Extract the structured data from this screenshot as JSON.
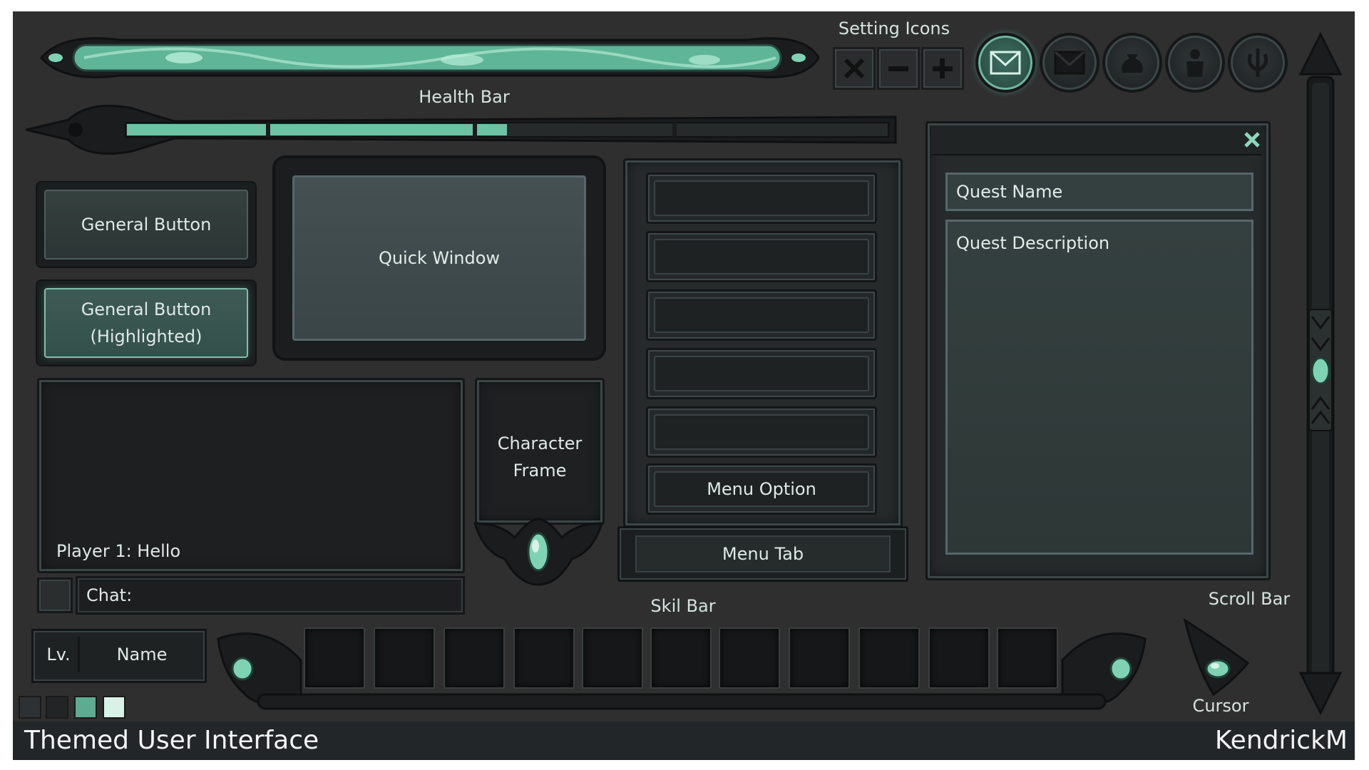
{
  "labels": {
    "setting_icons": "Setting Icons",
    "health_bar": "Health Bar",
    "skill_bar": "Skil Bar",
    "scroll_bar": "Scroll Bar",
    "cursor": "Cursor"
  },
  "buttons": {
    "general": "General Button",
    "highlighted_line1": "General Button",
    "highlighted_line2": "(Highlighted)"
  },
  "quick_window": {
    "label": "Quick Window"
  },
  "chat": {
    "message": "Player 1: Hello",
    "input_label": "Chat:"
  },
  "character_frame": {
    "line1": "Character",
    "line2": "Frame"
  },
  "menu": {
    "option_label": "Menu Option",
    "tab_label": "Menu Tab"
  },
  "quest": {
    "name": "Quest Name",
    "description": "Quest Description",
    "close_icon": "close-icon"
  },
  "player_plate": {
    "level": "Lv.",
    "name": "Name"
  },
  "health": {
    "segments_total": 4,
    "fill_fraction": 0.5
  },
  "skill_bar": {
    "slots": 11
  },
  "icons": [
    "close-icon",
    "minus-icon",
    "plus-icon",
    "mail-icon",
    "mail-icon",
    "bag-icon",
    "character-icon",
    "skills-icon"
  ],
  "palette": [
    "#2e3133",
    "#232425",
    "#5dab91",
    "#d8f2e8"
  ],
  "footer": {
    "title": "Themed User Interface",
    "author": "KendrickM"
  }
}
